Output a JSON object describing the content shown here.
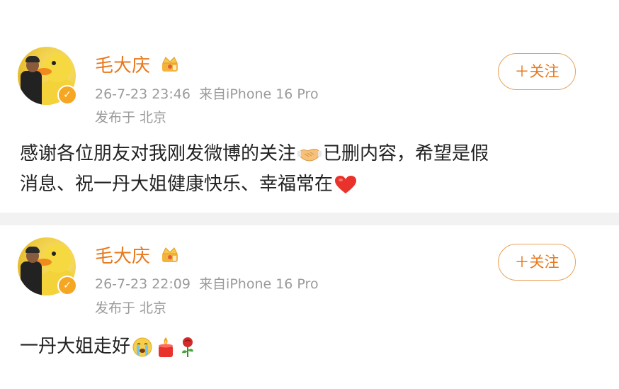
{
  "posts": [
    {
      "author": "毛大庆",
      "timestamp": "26-7-23 23:46",
      "source": "来自iPhone 16 Pro",
      "location": "发布于 北京",
      "follow_label": "关注",
      "content_part1": "感谢各位朋友对我刚发微博的关注",
      "content_part2": "已删内容，希望是假",
      "content_line2": "消息、祝一丹大姐健康快乐、幸福常在",
      "emojis": [
        "handshake-emoji",
        "red-heart-emoji"
      ]
    },
    {
      "author": "毛大庆",
      "timestamp": "26-7-23 22:09",
      "source": "来自iPhone 16 Pro",
      "location": "发布于 北京",
      "follow_label": "关注",
      "content": "一丹大姐走好",
      "emojis": [
        "crying-face-emoji",
        "candle-emoji",
        "rose-emoji"
      ]
    }
  ],
  "colors": {
    "name": "#e8791e",
    "meta": "#9a9a9a",
    "follow_border": "#e8a25a",
    "divider": "#f2f2f2",
    "verify_badge": "#f5a623"
  }
}
